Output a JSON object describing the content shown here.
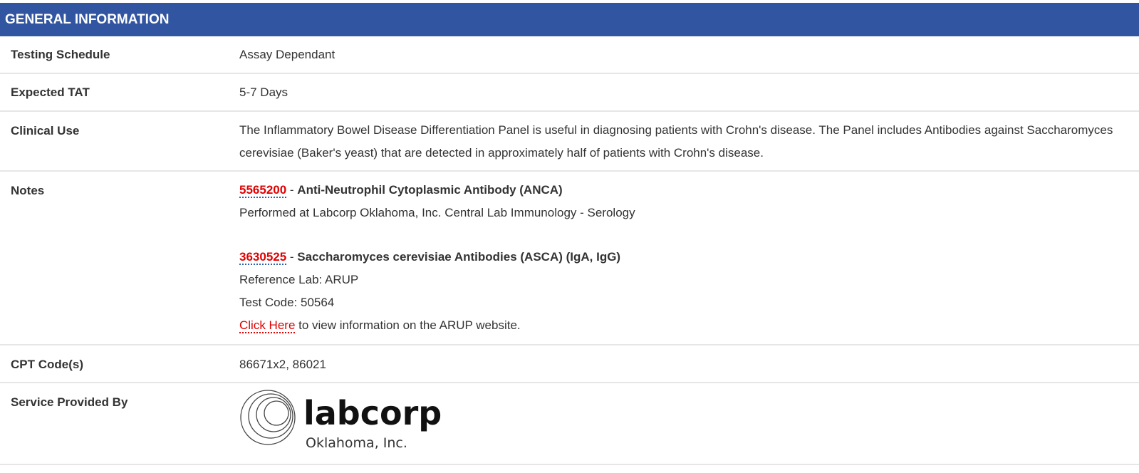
{
  "section_title": "GENERAL INFORMATION",
  "rows": {
    "testing_schedule": {
      "label": "Testing Schedule",
      "value": "Assay Dependant"
    },
    "expected_tat": {
      "label": "Expected TAT",
      "value": "5-7 Days"
    },
    "clinical_use": {
      "label": "Clinical Use",
      "value": "The Inflammatory Bowel Disease Differentiation Panel is useful in diagnosing patients with Crohn's disease. The Panel includes Antibodies against Saccharomyces cerevisiae (Baker's yeast) that are detected in approximately half of patients with Crohn's disease."
    },
    "notes": {
      "label": "Notes",
      "item1": {
        "code": "5565200",
        "sep": " - ",
        "title": "Anti-Neutrophil Cytoplasmic Antibody (ANCA)",
        "line": "Performed at Labcorp Oklahoma, Inc. Central Lab Immunology - Serology"
      },
      "item2": {
        "code": "3630525",
        "sep": " - ",
        "title": "Saccharomyces cerevisiae Antibodies (ASCA) (IgA, IgG)",
        "ref_lab": "Reference Lab: ARUP",
        "test_code": "Test Code: 50564",
        "link_text": "Click Here",
        "link_suffix": " to view information on the ARUP website."
      }
    },
    "cpt": {
      "label": "CPT Code(s)",
      "value": "86671x2, 86021"
    },
    "service": {
      "label": "Service Provided By",
      "logo_name": "labcorp",
      "logo_sub": "Oklahoma, Inc."
    }
  },
  "colors": {
    "header_bg": "#3155a0",
    "link_red": "#e00000",
    "link_underline_blue": "#2c5fb0",
    "divider": "#e6e6e6"
  }
}
